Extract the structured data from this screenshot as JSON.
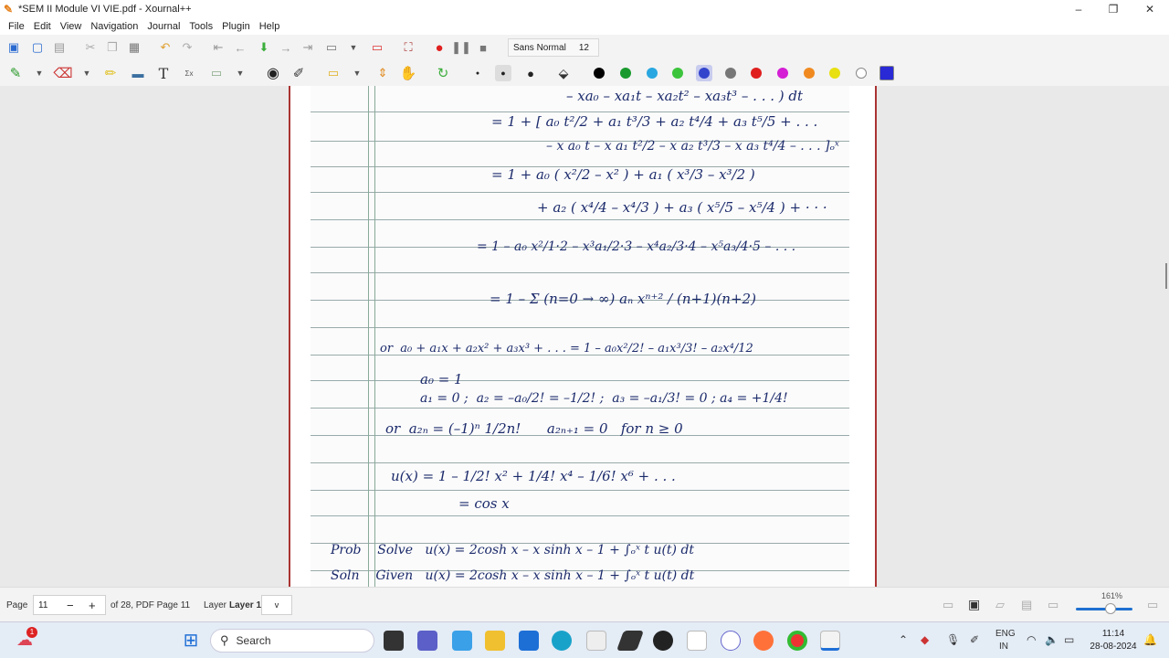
{
  "window": {
    "title": "*SEM II Module VI VIE.pdf - Xournal++",
    "min": "–",
    "max": "❐",
    "close": "✕"
  },
  "menu": [
    "File",
    "Edit",
    "View",
    "Navigation",
    "Journal",
    "Tools",
    "Plugin",
    "Help"
  ],
  "toolbar": {
    "font_name": "Sans Normal",
    "font_size": "12"
  },
  "colors": [
    "#000000",
    "#1a9a2e",
    "#2aa7e0",
    "#3cc43c",
    "#3344cc",
    "#777777",
    "#e01f1f",
    "#d41fd4",
    "#f08a20",
    "#e8e010",
    "#ffffff",
    "#2929d6"
  ],
  "note": {
    "lines": [
      "– xa₀ – xa₁t – xa₂t² – xa₃t³ – . . . ) dt",
      "= 1 + [ a₀ t²/2 + a₁ t³/3 + a₂ t⁴/4 + a₃ t⁵/5 + . . .",
      "– x a₀ t – x a₁ t²/2 – x a₂ t³/3 – x a₃ t⁴/4 – . . . ]ₒˣ",
      "= 1 + a₀ ( x²/2 – x² ) + a₁ ( x³/3 – x³/2 )",
      "+ a₂ ( x⁴/4 – x⁴/3 ) + a₃ ( x⁵/5 – x⁵/4 ) + · · ·",
      "= 1 – a₀ x²/1·2 – x³a₁/2·3 – x⁴a₂/3·4 – x⁵a₃/4·5 – . . .",
      "= 1 – Σ (n=0 → ∞) aₙ xⁿ⁺² / (n+1)(n+2)",
      "or  a₀ + a₁x + a₂x² + a₃x³ + . . . = 1 – a₀x²/2! – a₁x³/3! – a₂x⁴/12",
      "a₀ = 1",
      "a₁ = 0 ;  a₂ = –a₀/2! = –1/2! ;  a₃ = –a₁/3! = 0 ; a₄ = +1/4!",
      "or  a₂ₙ = (–1)ⁿ 1/2n!      a₂ₙ₊₁ = 0   for n ≥ 0",
      "u(x) = 1 – 1/2! x² + 1/4! x⁴ – 1/6! x⁶ + . . .",
      "= cos x",
      "Prob    Solve   u(x) = 2cosh x – x sinh x – 1 + ∫ₒˣ t u(t) dt",
      "Soln    Given   u(x) = 2cosh x – x sinh x – 1 + ∫ₒˣ t u(t) dt"
    ]
  },
  "status": {
    "page_label": "Page",
    "page_value": "11",
    "page_of": "of 28, PDF Page 11",
    "layer_label": "Layer",
    "layer_value": "Layer 1",
    "layer_arrow": "v",
    "zoom": "161%",
    "zoom_fraction": 0.62
  },
  "taskbar": {
    "search_placeholder": "Search",
    "notification_count": "1",
    "lang_top": "ENG",
    "lang_bottom": "IN",
    "time": "11:14",
    "date": "28-08-2024"
  }
}
